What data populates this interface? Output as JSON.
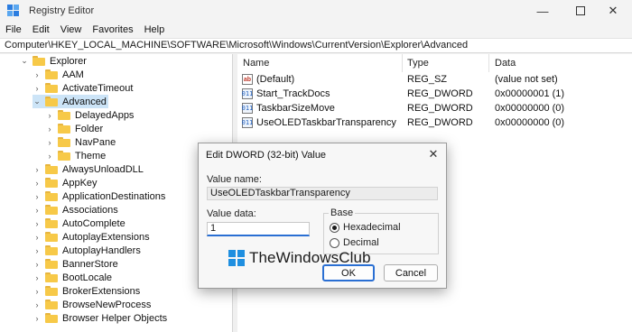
{
  "window": {
    "title": "Registry Editor"
  },
  "menu": [
    "File",
    "Edit",
    "View",
    "Favorites",
    "Help"
  ],
  "address": "Computer\\HKEY_LOCAL_MACHINE\\SOFTWARE\\Microsoft\\Windows\\CurrentVersion\\Explorer\\Advanced",
  "tree": [
    {
      "label": "Explorer",
      "expanded": true
    },
    {
      "label": "AAM"
    },
    {
      "label": "ActivateTimeout"
    },
    {
      "label": "Advanced",
      "expanded": true,
      "selected": true
    },
    {
      "label": "DelayedApps"
    },
    {
      "label": "Folder"
    },
    {
      "label": "NavPane"
    },
    {
      "label": "Theme"
    },
    {
      "label": "AlwaysUnloadDLL"
    },
    {
      "label": "AppKey"
    },
    {
      "label": "ApplicationDestinations"
    },
    {
      "label": "Associations"
    },
    {
      "label": "AutoComplete"
    },
    {
      "label": "AutoplayExtensions"
    },
    {
      "label": "AutoplayHandlers"
    },
    {
      "label": "BannerStore"
    },
    {
      "label": "BootLocale"
    },
    {
      "label": "BrokerExtensions"
    },
    {
      "label": "BrowseNewProcess"
    },
    {
      "label": "Browser Helper Objects"
    }
  ],
  "list": {
    "columns": [
      "Name",
      "Type",
      "Data"
    ],
    "rows": [
      {
        "icon": "ab",
        "name": "(Default)",
        "type": "REG_SZ",
        "data": "(value not set)"
      },
      {
        "icon": "011",
        "name": "Start_TrackDocs",
        "type": "REG_DWORD",
        "data": "0x00000001 (1)"
      },
      {
        "icon": "011",
        "name": "TaskbarSizeMove",
        "type": "REG_DWORD",
        "data": "0x00000000 (0)"
      },
      {
        "icon": "011",
        "name": "UseOLEDTaskbarTransparency",
        "type": "REG_DWORD",
        "data": "0x00000000 (0)"
      }
    ]
  },
  "dialog": {
    "title": "Edit DWORD (32-bit) Value",
    "value_name_label": "Value name:",
    "value_name": "UseOLEDTaskbarTransparency",
    "value_data_label": "Value data:",
    "value_data": "1",
    "base_label": "Base",
    "base_options": [
      "Hexadecimal",
      "Decimal"
    ],
    "base_selected": "Hexadecimal",
    "ok_label": "OK",
    "cancel_label": "Cancel"
  },
  "watermark": "TheWindowsClub",
  "colors": {
    "selection": "#cce4f7",
    "accent": "#2a6fd3",
    "folder": "#f7c948"
  }
}
